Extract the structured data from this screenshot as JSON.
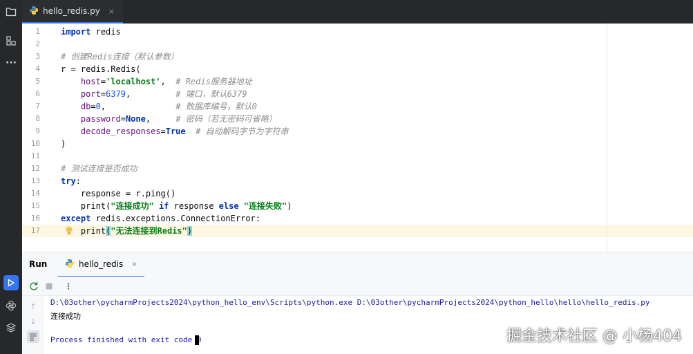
{
  "editor_tab": {
    "file_name": "hello_redis.py",
    "close_glyph": "×"
  },
  "left_toolbar": [
    {
      "name": "project-icon"
    },
    {
      "name": "structure-icon"
    },
    {
      "name": "more-icon",
      "glyph": "···"
    },
    {
      "name": "run-icon"
    },
    {
      "name": "python-console-icon"
    },
    {
      "name": "layers-icon"
    }
  ],
  "code_lines": [
    {
      "n": "1",
      "html": "<span class='kw'>import</span> redis"
    },
    {
      "n": "2",
      "html": ""
    },
    {
      "n": "3",
      "html": "<span class='cmt'># 创建Redis连接（默认参数）</span>"
    },
    {
      "n": "4",
      "html": "r = redis.Redis("
    },
    {
      "n": "5",
      "html": "    <span class='param'>host</span>=<span class='str'>'localhost'</span>,  <span class='cmt'># Redis服务器地址</span>"
    },
    {
      "n": "6",
      "html": "    <span class='param'>port</span>=<span class='num'>6379</span>,         <span class='cmt'># 端口，默认6379</span>"
    },
    {
      "n": "7",
      "html": "    <span class='param'>db</span>=<span class='num'>0</span>,              <span class='cmt'># 数据库编号，默认0</span>"
    },
    {
      "n": "8",
      "html": "    <span class='param'>password</span>=<span class='kw'>None</span>,     <span class='cmt'># 密码（若无密码可省略）</span>"
    },
    {
      "n": "9",
      "html": "    <span class='param'>decode_responses</span>=<span class='kw'>True</span>  <span class='cmt'># 自动解码字节为字符串</span>"
    },
    {
      "n": "10",
      "html": ")"
    },
    {
      "n": "11",
      "html": ""
    },
    {
      "n": "12",
      "html": "<span class='cmt'># 测试连接是否成功</span>"
    },
    {
      "n": "13",
      "html": "<span class='kw'>try</span>:"
    },
    {
      "n": "14",
      "html": "    response = r.ping()"
    },
    {
      "n": "15",
      "html": "    print(<span class='str'>\"连接成功\"</span> <span class='kw'>if</span> response <span class='kw'>else</span> <span class='str'>\"连接失败\"</span>)"
    },
    {
      "n": "16",
      "html": "<span class='kw'>except</span> redis.exceptions.ConnectionError:"
    },
    {
      "n": "17",
      "html": "    print<span class='brace-hl'>(</span><span class='str'>\"无法连接到Redis\"</span><span class='brace-hl'>)</span>"
    }
  ],
  "run_panel": {
    "title": "Run",
    "tab_label": "hello_redis",
    "close_glyph": "×"
  },
  "console_lines": [
    {
      "text": "D:\\03other\\pycharmProjects2024\\python_hello_env\\Scripts\\python.exe D:\\03other\\pycharmProjects2024\\python_hello\\hello\\hello_redis.py",
      "color": "#1a1aa6"
    },
    {
      "text": "连接成功",
      "color": "#000000"
    },
    {
      "text": "",
      "color": "#000000"
    },
    {
      "text": "Process finished with exit code 0",
      "color": "#1a1aa6"
    }
  ],
  "watermark": "掘金技术社区 @ 小杨404",
  "colors": {
    "accent": "#3574f0",
    "topbar": "#27282c"
  }
}
